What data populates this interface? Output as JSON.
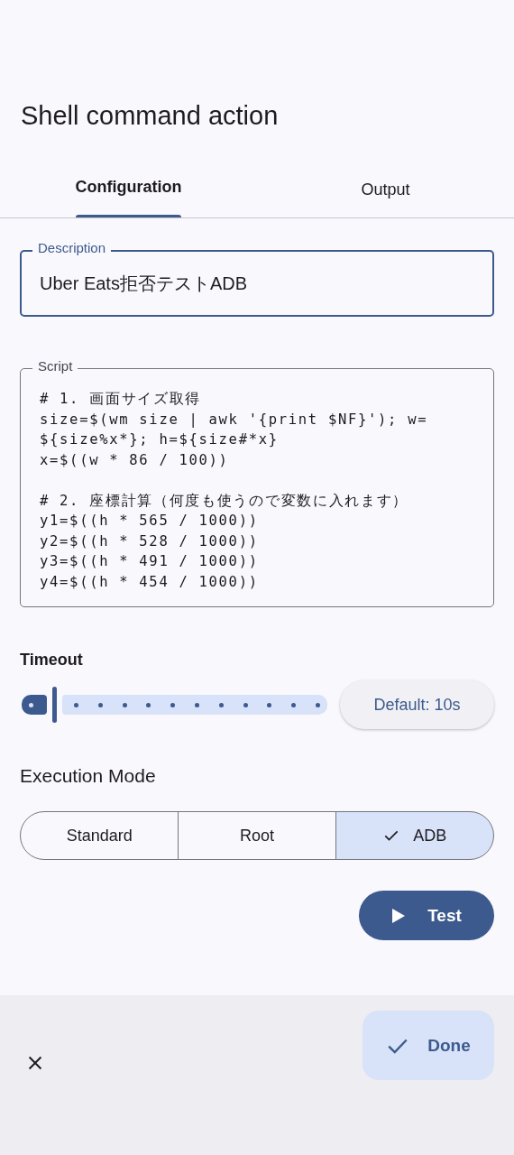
{
  "title": "Shell command action",
  "tabs": [
    {
      "label": "Configuration",
      "selected": true
    },
    {
      "label": "Output",
      "selected": false
    }
  ],
  "description": {
    "label": "Description",
    "value": "Uber Eats拒否テストADB",
    "focused": true
  },
  "script": {
    "label": "Script",
    "value": "# 1. 画面サイズ取得\nsize=$(wm size | awk '{print $NF}'); w=${size%x*}; h=${size#*x}\nx=$((w * 86 / 100))\n\n# 2. 座標計算（何度も使うので変数に入れます）\ny1=$((h * 565 / 1000))\ny2=$((h * 528 / 1000))\ny3=$((h * 491 / 1000))\ny4=$((h * 454 / 1000))"
  },
  "timeout": {
    "label": "Timeout",
    "level": 0,
    "default_button": "Default: 10s"
  },
  "execution_mode": {
    "label": "Execution Mode",
    "options": [
      {
        "label": "Standard",
        "selected": false
      },
      {
        "label": "Root",
        "selected": false
      },
      {
        "label": "ADB",
        "selected": true
      }
    ]
  },
  "test_button": "Test",
  "done_button": "Done"
}
